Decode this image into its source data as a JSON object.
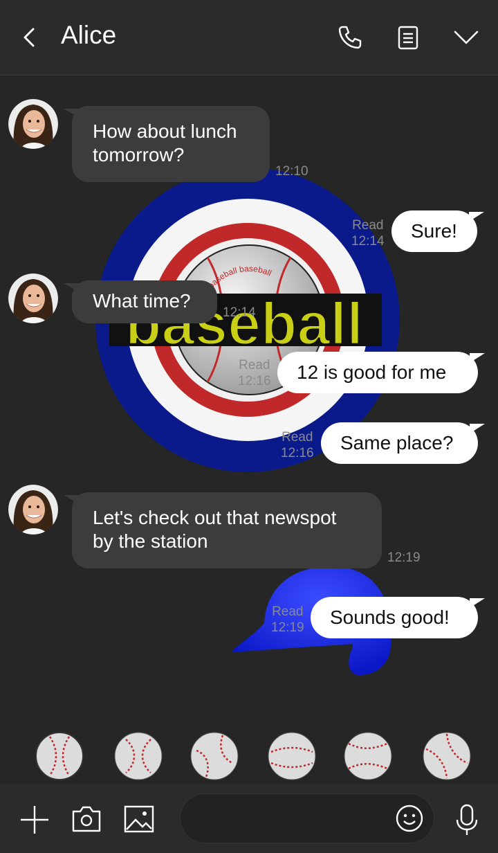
{
  "header": {
    "title": "Alice",
    "icons": [
      "back-icon",
      "phone-icon",
      "notes-icon",
      "chevron-down-icon"
    ]
  },
  "background": {
    "word": "baseball",
    "ring_text": "baseball baseball baseball",
    "colors": {
      "blue": "#0b1a8a",
      "red": "#c0282a",
      "yellow": "#c8cf14",
      "bright_blue": "#1f2ee0"
    }
  },
  "messages": [
    {
      "from": "Alice",
      "text_lines": [
        "How about lunch",
        "tomorrow?"
      ],
      "time": "12:10"
    },
    {
      "from": "me",
      "text": "Sure!",
      "read": "Read",
      "time": "12:14"
    },
    {
      "from": "Alice",
      "text_lines": [
        "What time?"
      ],
      "time": "12:14"
    },
    {
      "from": "me",
      "text": "12 is good for me",
      "read": "Read",
      "time": "12:16"
    },
    {
      "from": "me",
      "text": "Same place?",
      "read": "Read",
      "time": "12:16"
    },
    {
      "from": "Alice",
      "text_lines": [
        "Let's check out that newspot",
        "by the station"
      ],
      "time": "12:19"
    },
    {
      "from": "me",
      "text": "Sounds good!",
      "read": "Read",
      "time": "12:19"
    }
  ],
  "sticker_bar": {
    "items": [
      "baseball-sticker",
      "baseball-sticker",
      "baseball-sticker",
      "baseball-sticker",
      "baseball-sticker",
      "baseball-sticker"
    ]
  },
  "input_bar": {
    "placeholder": "",
    "icons": [
      "plus-icon",
      "camera-icon",
      "image-icon",
      "emoji-icon",
      "microphone-icon"
    ]
  }
}
